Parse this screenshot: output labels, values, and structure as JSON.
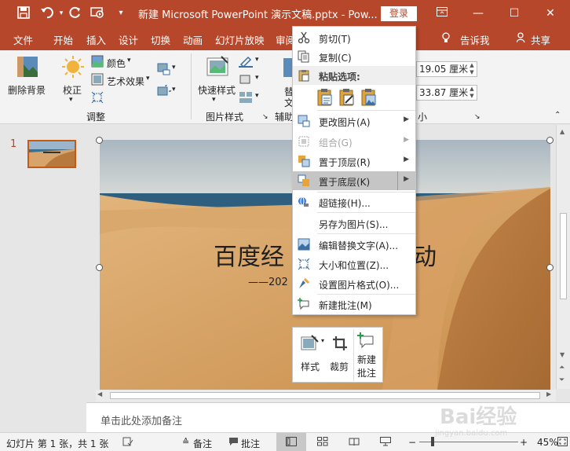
{
  "window": {
    "title": "新建 Microsoft PowerPoint 演示文稿.pptx  -  Pow...",
    "login_label": "登录",
    "quick_access": [
      "save-icon",
      "undo-icon",
      "redo-icon",
      "present-icon",
      "customize-icon"
    ]
  },
  "tabs": [
    "文件",
    "开始",
    "插入",
    "设计",
    "切换",
    "动画",
    "幻灯片放映",
    "审阅"
  ],
  "tell_me": "告诉我",
  "share": "共享",
  "ribbon": {
    "remove_bg": "删除背景",
    "corrections": "校正",
    "color": "颜色",
    "artistic": "艺术效果",
    "quick_styles": "快速样式",
    "alt_text_short": "替",
    "alt_text_short2": "文",
    "group_adjust": "调整",
    "group_styles": "图片样式",
    "group_aux": "辅助",
    "group_size": "小",
    "height": "19.05 厘米",
    "width": "33.87 厘米"
  },
  "slide": {
    "number": "1",
    "title_left": "百度经",
    "title_right": "动",
    "subtitle": "——202"
  },
  "context_menu": {
    "cut": "剪切(T)",
    "copy": "复制(C)",
    "paste_options": "粘贴选项:",
    "change_picture": "更改图片(A)",
    "group": "组合(G)",
    "bring_front": "置于顶层(R)",
    "send_back": "置于底层(K)",
    "hyperlink": "超链接(H)...",
    "save_as_picture": "另存为图片(S)...",
    "edit_alt_text": "编辑替换文字(A)...",
    "size_position": "大小和位置(Z)...",
    "format_picture": "设置图片格式(O)...",
    "new_comment": "新建批注(M)"
  },
  "mini_toolbar": {
    "style": "样式",
    "crop": "裁剪",
    "new_comment_1": "新建",
    "new_comment_2": "批注"
  },
  "notes_placeholder": "单击此处添加备注",
  "status": {
    "slide_info": "幻灯片 第 1 张，共 1 张",
    "notes": "备注",
    "comments": "批注",
    "zoom": "45%"
  },
  "watermark": {
    "text": "Bai经验",
    "url": "jingyan.baidu.com"
  },
  "colors": {
    "accent": "#b7472a",
    "ribbon_bg": "#f3f3f3",
    "menu_highlight": "#c5c5c5"
  }
}
